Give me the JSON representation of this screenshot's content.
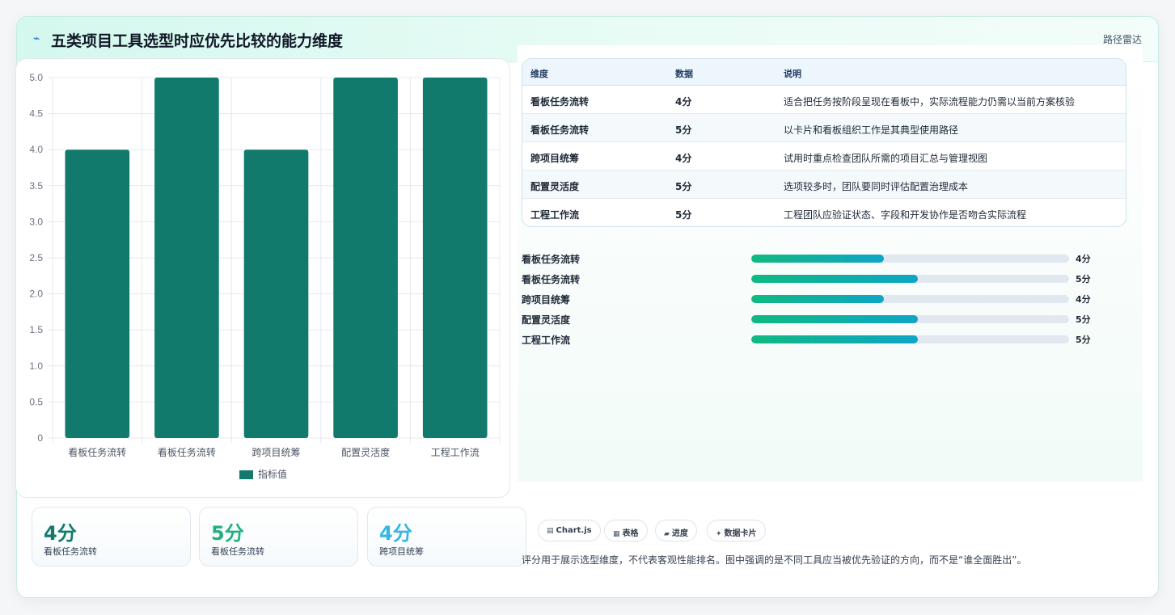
{
  "header": {
    "icon": "pulse-icon",
    "title": "五类项目工具选型时应优先比较的能力维度",
    "right_label": "路径雷达"
  },
  "chart_data": {
    "type": "bar",
    "categories": [
      "看板任务流转",
      "看板任务流转",
      "跨项目统筹",
      "配置灵活度",
      "工程工作流"
    ],
    "values": [
      4,
      5,
      4,
      5,
      5
    ],
    "ylim": [
      0,
      5
    ],
    "yticks": [
      "5.0",
      "4.5",
      "4.0",
      "3.5",
      "3.0",
      "2.5",
      "2.0",
      "1.5",
      "1.0",
      "0.5",
      "0"
    ],
    "legend": "指标值",
    "legend_position": "bottom",
    "grid": true,
    "color": "#127a6d"
  },
  "table": {
    "headers": [
      "维度",
      "数据",
      "说明"
    ],
    "rows": [
      {
        "dim": "看板任务流转",
        "data": "4分",
        "desc": "适合把任务按阶段呈现在看板中，实际流程能力仍需以当前方案核验"
      },
      {
        "dim": "看板任务流转",
        "data": "5分",
        "desc": "以卡片和看板组织工作是其典型使用路径"
      },
      {
        "dim": "跨项目统筹",
        "data": "4分",
        "desc": "试用时重点检查团队所需的项目汇总与管理视图"
      },
      {
        "dim": "配置灵活度",
        "data": "5分",
        "desc": "选项较多时，团队要同时评估配置治理成本"
      },
      {
        "dim": "工程工作流",
        "data": "5分",
        "desc": "工程团队应验证状态、字段和开发协作是否吻合实际流程"
      }
    ]
  },
  "progress": [
    {
      "label": "看板任务流转",
      "value": "4分",
      "fraction": 0.417
    },
    {
      "label": "看板任务流转",
      "value": "5分",
      "fraction": 0.525
    },
    {
      "label": "跨项目统筹",
      "value": "4分",
      "fraction": 0.417
    },
    {
      "label": "配置灵活度",
      "value": "5分",
      "fraction": 0.525
    },
    {
      "label": "工程工作流",
      "value": "5分",
      "fraction": 0.525
    }
  ],
  "stats": [
    {
      "value": "4分",
      "label": "看板任务流转",
      "color": "#127a6d"
    },
    {
      "value": "5分",
      "label": "看板任务流转",
      "color": "#22b07d"
    },
    {
      "value": "4分",
      "label": "跨项目统筹",
      "color": "#35b7e0"
    }
  ],
  "chips": [
    {
      "icon": "chart-icon",
      "glyph": "▤",
      "label": "Chart.js"
    },
    {
      "icon": "table-icon",
      "glyph": "▦",
      "label": "表格"
    },
    {
      "icon": "progress-icon",
      "glyph": "▰",
      "label": "进度"
    },
    {
      "icon": "sparkle-icon",
      "glyph": "✦",
      "label": "数据卡片"
    }
  ],
  "note": "评分用于展示选型维度，不代表客观性能排名。图中强调的是不同工具应当被优先验证的方向，而不是“谁全面胜出”。"
}
